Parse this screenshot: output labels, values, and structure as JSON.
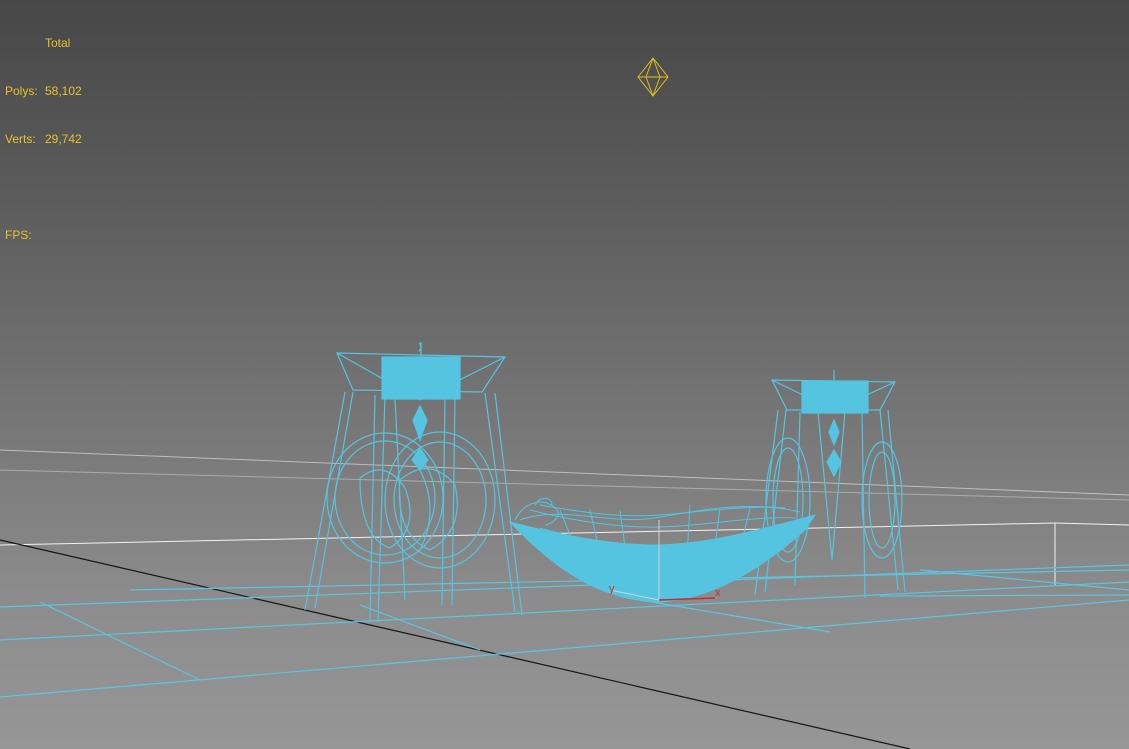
{
  "viewport": {
    "background_top": "#474747",
    "background_bottom": "#969696"
  },
  "stats": {
    "column_header": "Total",
    "polys_label": "Polys:",
    "polys_value": "58,102",
    "verts_label": "Verts:",
    "verts_value": "29,742",
    "fps_label": "FPS:",
    "text_color": "#e8c12a"
  },
  "gizmo": {
    "x_label": "x",
    "y_label": "y",
    "x_color": "#c03030",
    "y_color": "#d2d2d2"
  },
  "colors": {
    "wireframe": "#55c4e0",
    "grid_line": "#5bc5e2",
    "home_grid": "#1a1a1a",
    "horizon": "#e6e6e6",
    "light_icon": "#e0c020"
  },
  "scene_objects": [
    "left-candle-stand",
    "right-candle-stand",
    "hammock-bowl",
    "omni-light"
  ]
}
